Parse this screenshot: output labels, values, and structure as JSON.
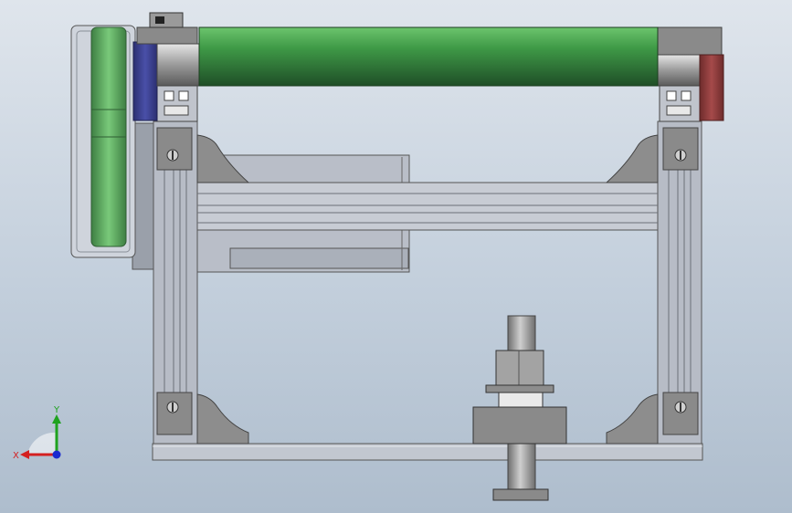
{
  "viewport": {
    "background_top": "#dfe5ec",
    "background_bottom": "#aebdcd"
  },
  "model": {
    "roller_color": "#3f9a47",
    "belt_color": "#6fbf70",
    "end_cap_left_color": "#3a3f8f",
    "end_cap_right_color": "#8a3a3a",
    "frame_color": "#b7bcc6",
    "part_gray": "#8a8a8a"
  },
  "triad": {
    "x_label": "X",
    "y_label": "Y",
    "x_color": "#d42020",
    "y_color": "#1fa21f",
    "z_color": "#1a2ad0"
  }
}
